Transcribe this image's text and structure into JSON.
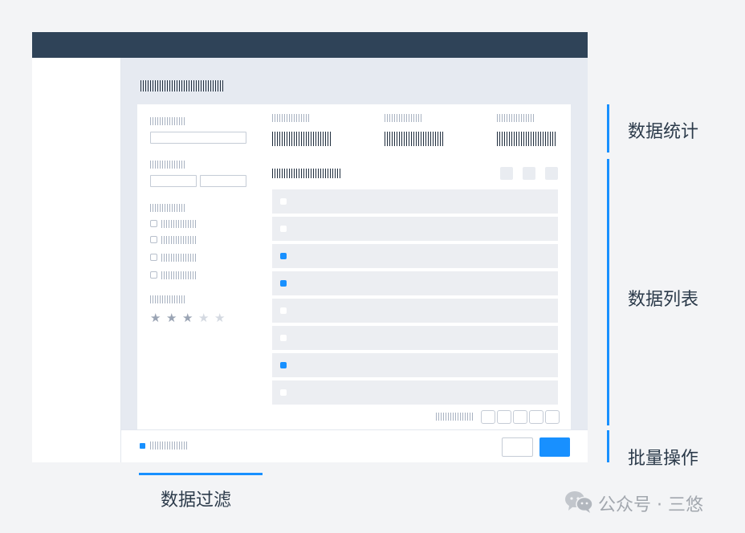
{
  "annotations": {
    "stats": "数据统计",
    "list": "数据列表",
    "batch": "批量操作",
    "filter": "数据过滤"
  },
  "watermark": {
    "text": "公众号 · 三悠",
    "icon": "wechat-icon"
  },
  "filters": {
    "rating": 3,
    "rating_max": 5
  },
  "list_rows": [
    {
      "selected": false
    },
    {
      "selected": false
    },
    {
      "selected": true
    },
    {
      "selected": true
    },
    {
      "selected": false
    },
    {
      "selected": false
    },
    {
      "selected": true
    },
    {
      "selected": false
    }
  ],
  "pagination": {
    "page_count": 5
  },
  "colors": {
    "accent": "#1890ff",
    "topbar": "#2f4358",
    "content_bg": "#e6eaf1"
  }
}
